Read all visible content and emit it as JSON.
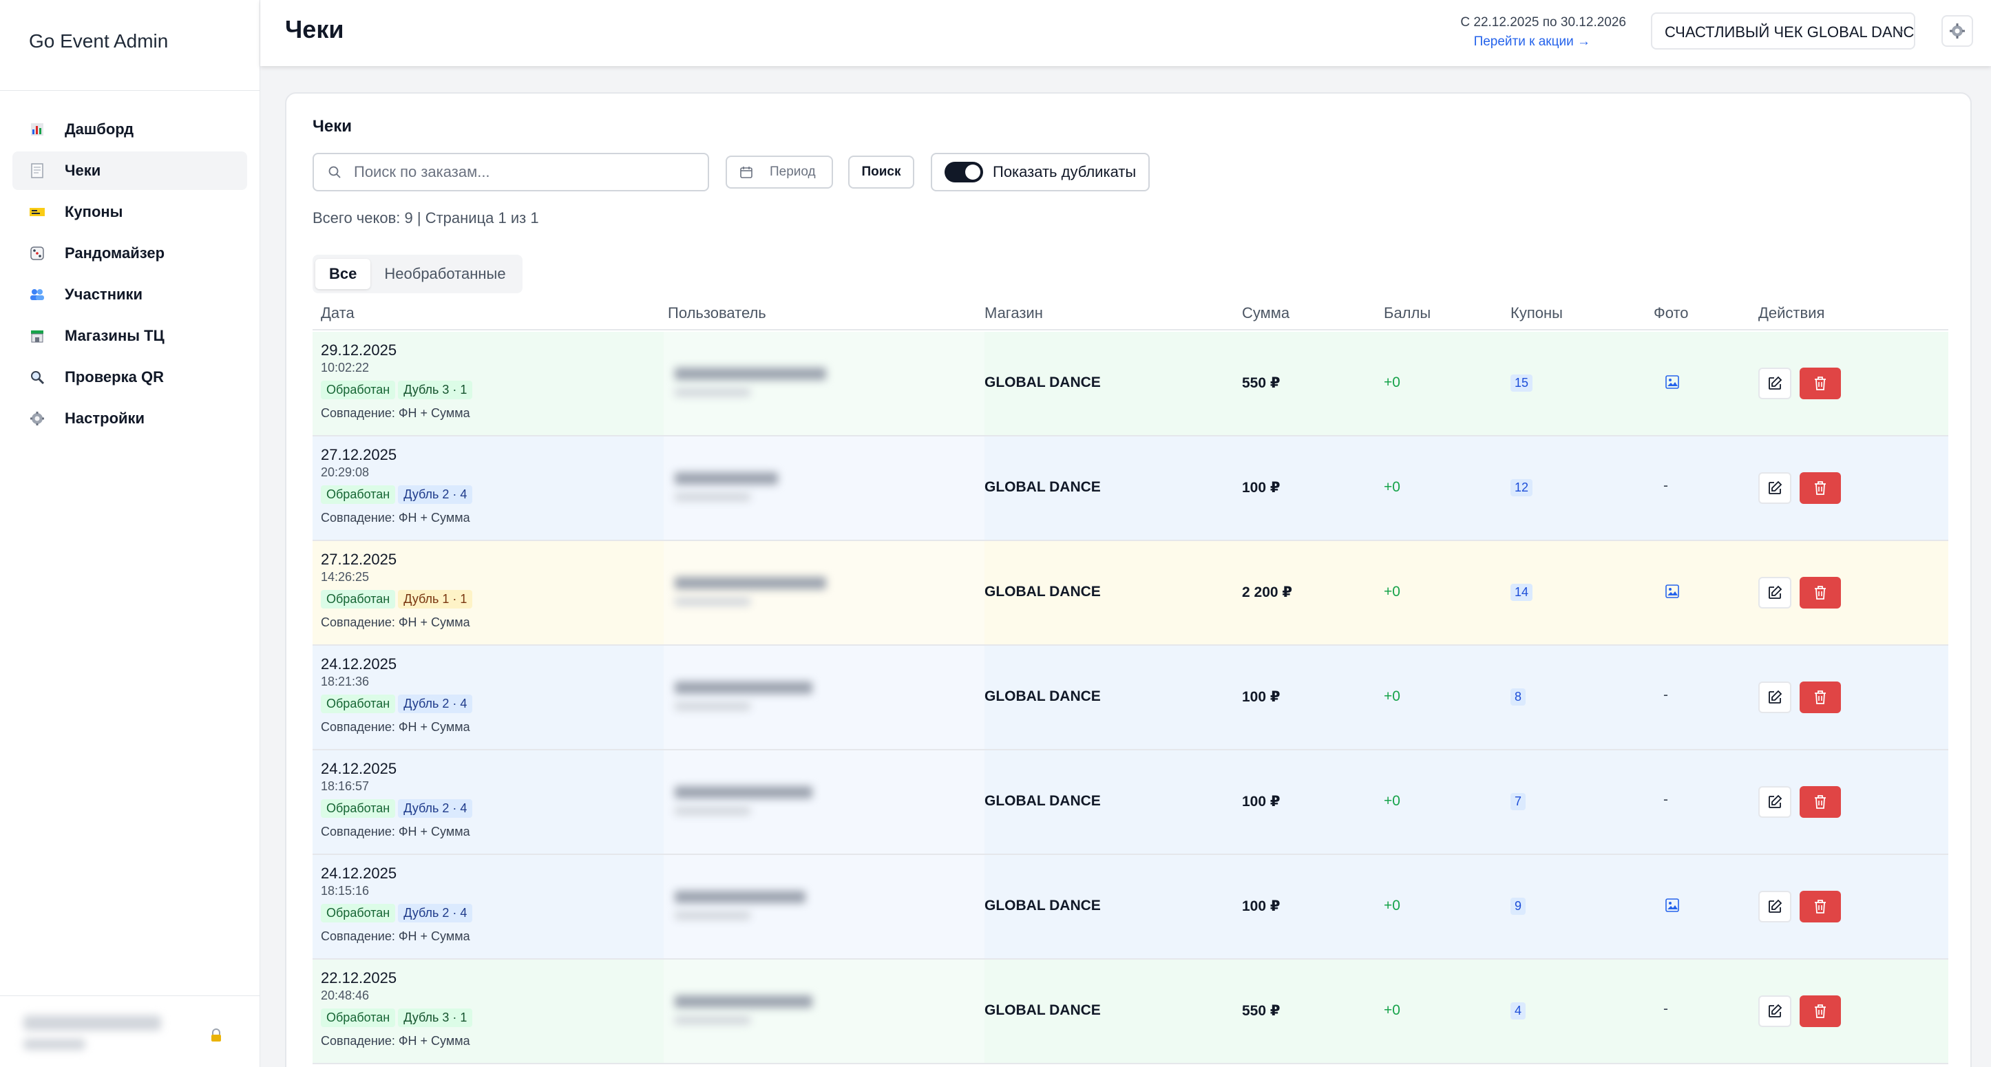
{
  "app": {
    "brand": "Go Event Admin"
  },
  "sidebar": {
    "items": [
      {
        "label": "Дашборд",
        "icon": "bar-chart-icon",
        "active": false
      },
      {
        "label": "Чеки",
        "icon": "receipt-icon",
        "active": true
      },
      {
        "label": "Купоны",
        "icon": "ticket-icon",
        "active": false
      },
      {
        "label": "Рандомайзер",
        "icon": "dice-icon",
        "active": false
      },
      {
        "label": "Участники",
        "icon": "users-icon",
        "active": false
      },
      {
        "label": "Магазины ТЦ",
        "icon": "store-icon",
        "active": false
      },
      {
        "label": "Проверка QR",
        "icon": "magnifier-icon",
        "active": false
      },
      {
        "label": "Настройки",
        "icon": "gear-icon",
        "active": false
      }
    ]
  },
  "header": {
    "title": "Чеки",
    "period": "С 22.12.2025 по 30.12.2026",
    "promo_link": "Перейти к акции →",
    "promo_select": "СЧАСТЛИВЫЙ ЧЕК GLOBAL DANCE"
  },
  "main": {
    "card_title": "Чеки",
    "search_placeholder": "Поиск по заказам...",
    "period_button": "Период",
    "search_button": "Поиск",
    "duplicates_toggle": "Показать дубликаты",
    "duplicates_on": true,
    "summary": "Всего чеков: 9 | Страница 1 из 1",
    "tabs": [
      {
        "label": "Все",
        "active": true
      },
      {
        "label": "Необработанные",
        "active": false
      }
    ],
    "columns": {
      "date": "Дата",
      "user": "Пользователь",
      "shop": "Магазин",
      "sum": "Сумма",
      "points": "Баллы",
      "coupons": "Купоны",
      "photo": "Фото",
      "actions": "Действия"
    },
    "rows": [
      {
        "date": "29.12.2025",
        "time": "10:02:22",
        "status": "Обработан",
        "dup": "Дубль 3 · 1",
        "match": "Совпадение: ФН + Сумма",
        "shop": "GLOBAL DANCE",
        "sum": "550 ₽",
        "points": "+0",
        "coupons": "15",
        "photo": true,
        "tone": "green"
      },
      {
        "date": "27.12.2025",
        "time": "20:29:08",
        "status": "Обработан",
        "dup": "Дубль 2 · 4",
        "match": "Совпадение: ФН + Сумма",
        "shop": "GLOBAL DANCE",
        "sum": "100 ₽",
        "points": "+0",
        "coupons": "12",
        "photo": false,
        "photo_empty": "-",
        "tone": "blue"
      },
      {
        "date": "27.12.2025",
        "time": "14:26:25",
        "status": "Обработан",
        "dup": "Дубль 1 · 1",
        "match": "Совпадение: ФН + Сумма",
        "shop": "GLOBAL DANCE",
        "sum": "2 200 ₽",
        "points": "+0",
        "coupons": "14",
        "photo": true,
        "tone": "yellow"
      },
      {
        "date": "24.12.2025",
        "time": "18:21:36",
        "status": "Обработан",
        "dup": "Дубль 2 · 4",
        "match": "Совпадение: ФН + Сумма",
        "shop": "GLOBAL DANCE",
        "sum": "100 ₽",
        "points": "+0",
        "coupons": "8",
        "photo": false,
        "photo_empty": "-",
        "tone": "blue"
      },
      {
        "date": "24.12.2025",
        "time": "18:16:57",
        "status": "Обработан",
        "dup": "Дубль 2 · 4",
        "match": "Совпадение: ФН + Сумма",
        "shop": "GLOBAL DANCE",
        "sum": "100 ₽",
        "points": "+0",
        "coupons": "7",
        "photo": false,
        "photo_empty": "-",
        "tone": "blue"
      },
      {
        "date": "24.12.2025",
        "time": "18:15:16",
        "status": "Обработан",
        "dup": "Дубль 2 · 4",
        "match": "Совпадение: ФН + Сумма",
        "shop": "GLOBAL DANCE",
        "sum": "100 ₽",
        "points": "+0",
        "coupons": "9",
        "photo": true,
        "tone": "blue"
      },
      {
        "date": "22.12.2025",
        "time": "20:48:46",
        "status": "Обработан",
        "dup": "Дубль 3 · 1",
        "match": "Совпадение: ФН + Сумма",
        "shop": "GLOBAL DANCE",
        "sum": "550 ₽",
        "points": "+0",
        "coupons": "4",
        "photo": false,
        "photo_empty": "-",
        "tone": "green"
      }
    ]
  },
  "colors": {
    "accent": "#2563eb",
    "danger": "#e04545",
    "points": "#16a34a",
    "row_green": "#effbf3",
    "row_blue": "#eef5fd",
    "row_yellow": "#fefbeb"
  }
}
